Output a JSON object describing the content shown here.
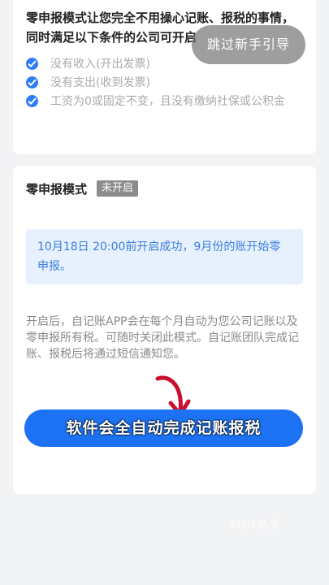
{
  "intro": {
    "text": "零申报模式让您完全不用操心记账、报税的事情，同时满足以下条件的公司可开启",
    "conditions": [
      "没有收入(开出发票)",
      "没有支出(收到发票)",
      "工资为0或固定不变，且没有缴纳社保或公积金"
    ]
  },
  "guide": {
    "skip_label": "跳过新手引导"
  },
  "mode": {
    "title": "零申报模式",
    "status_badge": "未开启",
    "notice": "10月18日 20:00前开启成功，9月份的账开始零申报。",
    "description": "开启后，自记账APP会在每个月自动为您公司记账以及零申报所有税。可随时关闭此模式。自记账团队完成记账、报税后将通过短信通知您。",
    "cta_label": "软件会全自动完成记账报税"
  },
  "watermark": "PDM助手",
  "colors": {
    "primary": "#1c72f2",
    "check": "#2f7cf6",
    "notice_bg": "#e7f1fd",
    "notice_text": "#3a7fdc",
    "badge_bg": "#8c8c8c",
    "arrow": "#c8102e"
  }
}
